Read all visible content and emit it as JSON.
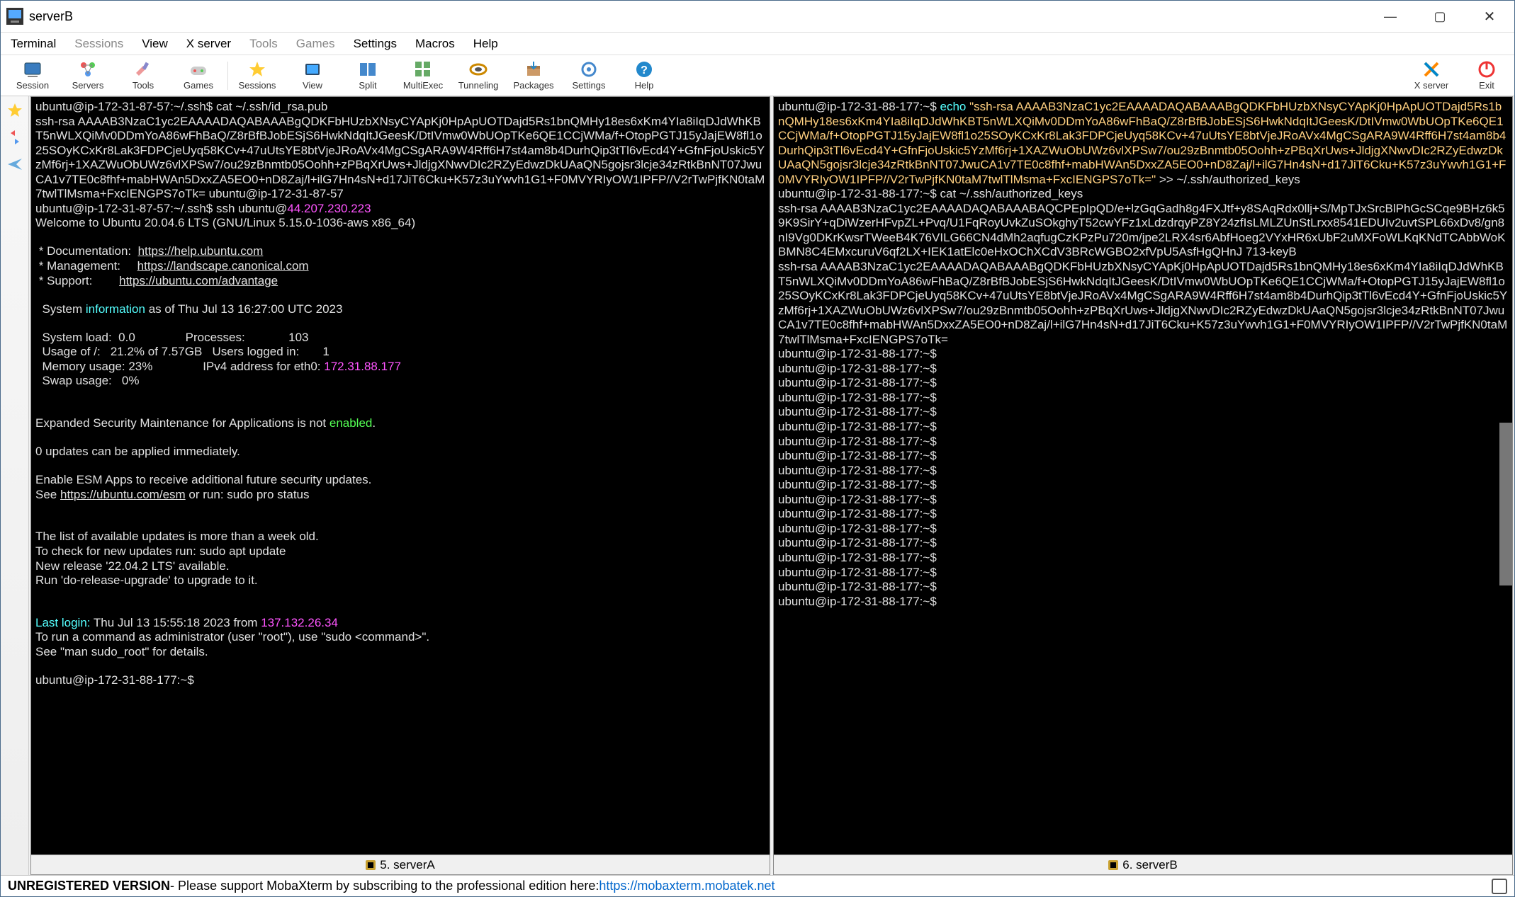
{
  "title": "serverB",
  "menu": [
    "Terminal",
    "Sessions",
    "View",
    "X server",
    "Tools",
    "Games",
    "Settings",
    "Macros",
    "Help"
  ],
  "menu_gray": [
    1,
    4,
    5
  ],
  "tools": [
    {
      "label": "Session"
    },
    {
      "label": "Servers"
    },
    {
      "label": "Tools"
    },
    {
      "label": "Games"
    },
    {
      "label": "Sessions"
    },
    {
      "label": "View"
    },
    {
      "label": "Split"
    },
    {
      "label": "MultiExec"
    },
    {
      "label": "Tunneling"
    },
    {
      "label": "Packages"
    },
    {
      "label": "Settings"
    },
    {
      "label": "Help"
    }
  ],
  "tools_right": [
    {
      "label": "X server"
    },
    {
      "label": "Exit"
    }
  ],
  "left_tab": "5. serverA",
  "right_tab": "6. serverB",
  "left_term": {
    "l1_prompt": "ubuntu@ip-172-31-87-57:~/.ssh$",
    "l1_cmd": " cat ~/.ssh/id_rsa.pub",
    "key": "ssh-rsa AAAAB3NzaC1yc2EAAAADAQABAAABgQDKFbHUzbXNsyCYApKj0HpApUOTDajd5Rs1bnQMHy18es6xKm4YIa8iIqDJdWhKBT5nWLXQiMv0DDmYoA86wFhBaQ/Z8rBfBJobESjS6HwkNdqItJGeesK/DtIVmw0WbUOpTKe6QE1CCjWMa/f+OtopPGTJ15yJajEW8fl1o25SOyKCxKr8Lak3FDPCjeUyq58KCv+47uUtsYE8btVjeJRoAVx4MgCSgARA9W4Rff6H7st4am8b4DurhQip3tTl6vEcd4Y+GfnFjoUskic5YzMf6rj+1XAZWuObUWz6vlXPSw7/ou29zBnmtb05Oohh+zPBqXrUws+JldjgXNwvDIc2RZyEdwzDkUAaQN5gojsr3lcje34zRtkBnNT07JwuCA1v7TE0c8fhf+mabHWAn5DxxZA5EO0+nD8Zaj/l+ilG7Hn4sN+d17JiT6Cku+K57z3uYwvh1G1+F0MVYRIyOW1IPFP//V2rTwPjfKN0taM7twlTlMsma+FxcIENGPS7oTk= ubuntu@ip-172-31-87-57",
    "l2_prompt": "ubuntu@ip-172-31-87-57:~/.ssh$",
    "l2_cmd1": " ssh ubuntu@",
    "l2_ip": "44.207.230.223",
    "welcome": "Welcome to Ubuntu 20.04.6 LTS (GNU/Linux 5.15.0-1036-aws x86_64)",
    "doc_l": " * Documentation:  ",
    "doc_u": "https://help.ubuntu.com",
    "mgmt_l": " * Management:     ",
    "mgmt_u": "https://landscape.canonical.com",
    "sup_l": " * Support:        ",
    "sup_u": "https://ubuntu.com/advantage",
    "sysinfo_pre": "  System ",
    "sysinfo_word": "information",
    "sysinfo_post": " as of Thu Jul 13 16:27:00 UTC 2023",
    "stat1": "  System load:  0.0               Processes:             103",
    "stat2": "  Usage of /:   21.2% of 7.57GB   Users logged in:       1",
    "stat3a": "  Memory usage: 23%               IPv4 address for eth0: ",
    "stat3b": "172.31.88.177",
    "stat4": "  Swap usage:   0%",
    "esm1a": "Expanded Security Maintenance for Applications is not ",
    "esm1b": "enabled",
    "esm1c": ".",
    "upd": "0 updates can be applied immediately.",
    "esm2": "Enable ESM Apps to receive additional future security updates.",
    "esm3a": "See ",
    "esm3b": "https://ubuntu.com/esm",
    "esm3c": " or run: sudo pro status",
    "old1": "The list of available updates is more than a week old.",
    "old2": "To check for new updates run: sudo apt update",
    "rel1": "New release '22.04.2 LTS' available.",
    "rel2": "Run 'do-release-upgrade' to upgrade to it.",
    "ll_a": "Last login:",
    "ll_b": " Thu Jul 13 15:55:18 2023 from ",
    "ll_c": "137.132.26.34",
    "sudo1": "To run a command as administrator (user \"root\"), use \"sudo <command>\".",
    "sudo2": "See \"man sudo_root\" for details.",
    "end_prompt": "ubuntu@ip-172-31-88-177:~$"
  },
  "right_term": {
    "p1": "ubuntu@ip-172-31-88-177:~$",
    "echo": " echo ",
    "str": "\"ssh-rsa AAAAB3NzaC1yc2EAAAADAQABAAABgQDKFbHUzbXNsyCYApKj0HpApUOTDajd5Rs1bnQMHy18es6xKm4YIa8iIqDJdWhKBT5nWLXQiMv0DDmYoA86wFhBaQ/Z8rBfBJobESjS6HwkNdqItJGeesK/DtIVmw0WbUOpTKe6QE1CCjWMa/f+OtopPGTJ15yJajEW8fl1o25SOyKCxKr8Lak3FDPCjeUyq58KCv+47uUtsYE8btVjeJRoAVx4MgCSgARA9W4Rff6H7st4am8b4DurhQip3tTl6vEcd4Y+GfnFjoUskic5YzMf6rj+1XAZWuObUWz6vlXPSw7/ou29zBnmtb05Oohh+zPBqXrUws+JldjgXNwvDIc2RZyEdwzDkUAaQN5gojsr3lcje34zRtkBnNT07JwuCA1v7TE0c8fhf+mabHWAn5DxxZA5EO0+nD8Zaj/l+ilG7Hn4sN+d17JiT6Cku+K57z3uYwvh1G1+F0MVYRIyOW1IPFP//V2rTwPjfKN0taM7twlTlMsma+FxcIENGPS7oTk=\"",
    "redir": " >> ~/.ssh/authorized_keys",
    "p2": "ubuntu@ip-172-31-88-177:~$",
    "cat": " cat ~/.ssh/authorized_keys",
    "key1": "ssh-rsa AAAAB3NzaC1yc2EAAAADAQABAAABAQCPEpIpQD/e+lzGqGadh8g4FXJtf+y8SAqRdx0llj+S/MpTJxSrcBlPhGcSCqe9BHz6k59K9SirY+qDiWzerHFvpZL+Pvq/U1FqRoyUvkZuSOkghyT52cwYFz1xLdzdrqyPZ8Y24zfIsLMLZUnStLrxx8541EDUIv2uvtSPL66xDv8/gn8nI9Vg0DKrKwsrTWeeB4K76VILG66CN4dMh2aqfugCzKPzPu720m/jpe2LRX4sr6AbfHoeg2VYxHR6xUbF2uMXFoWLKqKNdTCAbbWoKBMN8C4EMxcuruV6qf2LX+IEK1atElc0eHxOChXCdV3BRcWGBO2xfVpU5AsfHgQHnJ 713-keyB",
    "key2": "ssh-rsa AAAAB3NzaC1yc2EAAAADAQABAAABgQDKFbHUzbXNsyCYApKj0HpApUOTDajd5Rs1bnQMHy18es6xKm4YIa8iIqDJdWhKBT5nWLXQiMv0DDmYoA86wFhBaQ/Z8rBfBJobESjS6HwkNdqItJGeesK/DtIVmw0WbUOpTKe6QE1CCjWMa/f+OtopPGTJ15yJajEW8fl1o25SOyKCxKr8Lak3FDPCjeUyq58KCv+47uUtsYE8btVjeJRoAVx4MgCSgARA9W4Rff6H7st4am8b4DurhQip3tTl6vEcd4Y+GfnFjoUskic5YzMf6rj+1XAZWuObUWz6vlXPSw7/ou29zBnmtb05Oohh+zPBqXrUws+JldjgXNwvDIc2RZyEdwzDkUAaQN5gojsr3lcje34zRtkBnNT07JwuCA1v7TE0c8fhf+mabHWAn5DxxZA5EO0+nD8Zaj/l+ilG7Hn4sN+d17JiT6Cku+K57z3uYwvh1G1+F0MVYRIyOW1IPFP//V2rTwPjfKN0taM7twlTlMsma+FxcIENGPS7oTk=",
    "blank_prompt": "ubuntu@ip-172-31-88-177:~$",
    "blank_count": 18
  },
  "status": {
    "bold": "UNREGISTERED VERSION",
    "text": "  -  Please support MobaXterm by subscribing to the professional edition here:  ",
    "link": "https://mobaxterm.mobatek.net"
  }
}
